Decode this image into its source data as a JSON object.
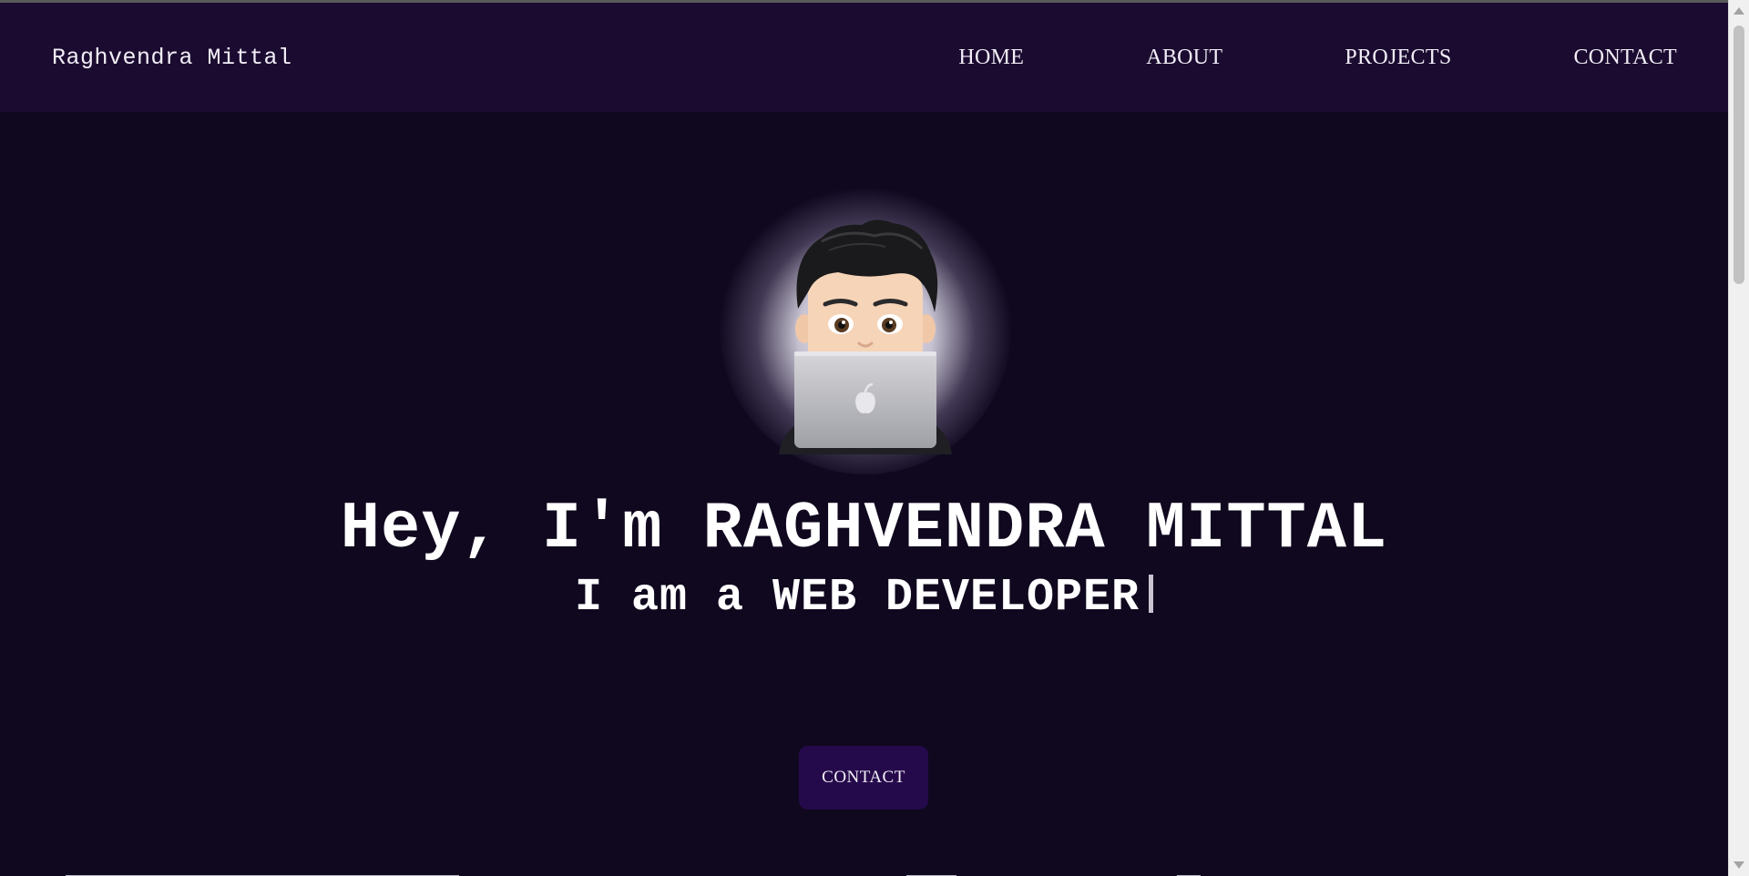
{
  "navbar": {
    "brand": "Raghvendra Mittal",
    "links": [
      {
        "label": "HOME"
      },
      {
        "label": "ABOUT"
      },
      {
        "label": "PROJECTS"
      },
      {
        "label": "CONTACT"
      }
    ]
  },
  "hero": {
    "avatar_icon": "memoji-laptop-avatar",
    "headline": "Hey, I'm RAGHVENDRA MITTAL",
    "subline": "I am a WEB DEVELOPER",
    "cta_label": "CONTACT"
  },
  "colors": {
    "background": "#10081f",
    "navbar": "#1b0b30",
    "cta": "#250a4b",
    "text": "#ffffff"
  }
}
